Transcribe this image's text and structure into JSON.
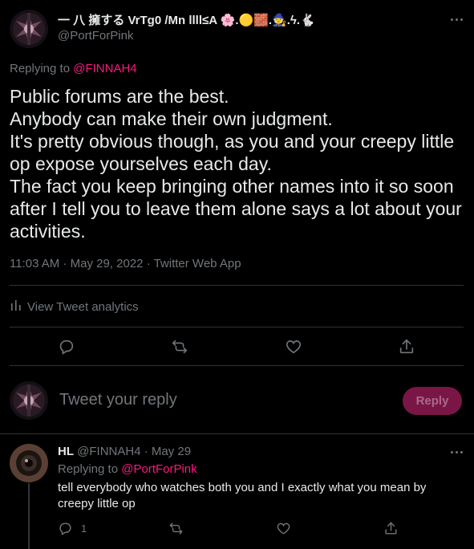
{
  "tweet": {
    "author_name": "一 八 擁する VrTg0 /Mn llll≤A 🌸.🟡🧱.🧙.ϟ.🐇",
    "author_handle": "@PortForPink",
    "replying_to_prefix": "Replying to",
    "replying_to_handle": "@FINNAH4",
    "body_lines": [
      "Public forums are the best.",
      "Anybody can make their own judgment.",
      "It's pretty obvious though, as you and your creepy little",
      "op expose yourselves each day.",
      "The fact you keep bringing other names into it so soon",
      "after I tell you to leave them alone says a lot about your",
      "activities."
    ],
    "time": "11:03 AM",
    "date": "May 29, 2022",
    "source": "Twitter Web App",
    "analytics_label": "View Tweet analytics"
  },
  "composer": {
    "placeholder": "Tweet your reply",
    "button_label": "Reply"
  },
  "reply": {
    "name": "HL",
    "handle": "@FINNAH4",
    "date": "May 29",
    "replying_to_prefix": "Replying to",
    "replying_to_handle": "@PortForPink",
    "text_lines": [
      "tell everybody who watches both you and I exactly what you mean by",
      "creepy little op"
    ],
    "reply_count": "1"
  },
  "colors": {
    "background": "#000000",
    "text": "#e7e9ea",
    "muted": "#71767b",
    "accent": "#f91880",
    "reply_button": "#7a1646",
    "divider": "#2f3336"
  },
  "icons": {
    "more": "more-horizontal-icon",
    "analytics": "bar-chart-icon",
    "reply": "speech-bubble-icon",
    "retweet": "retweet-icon",
    "like": "heart-icon",
    "share": "share-icon"
  }
}
